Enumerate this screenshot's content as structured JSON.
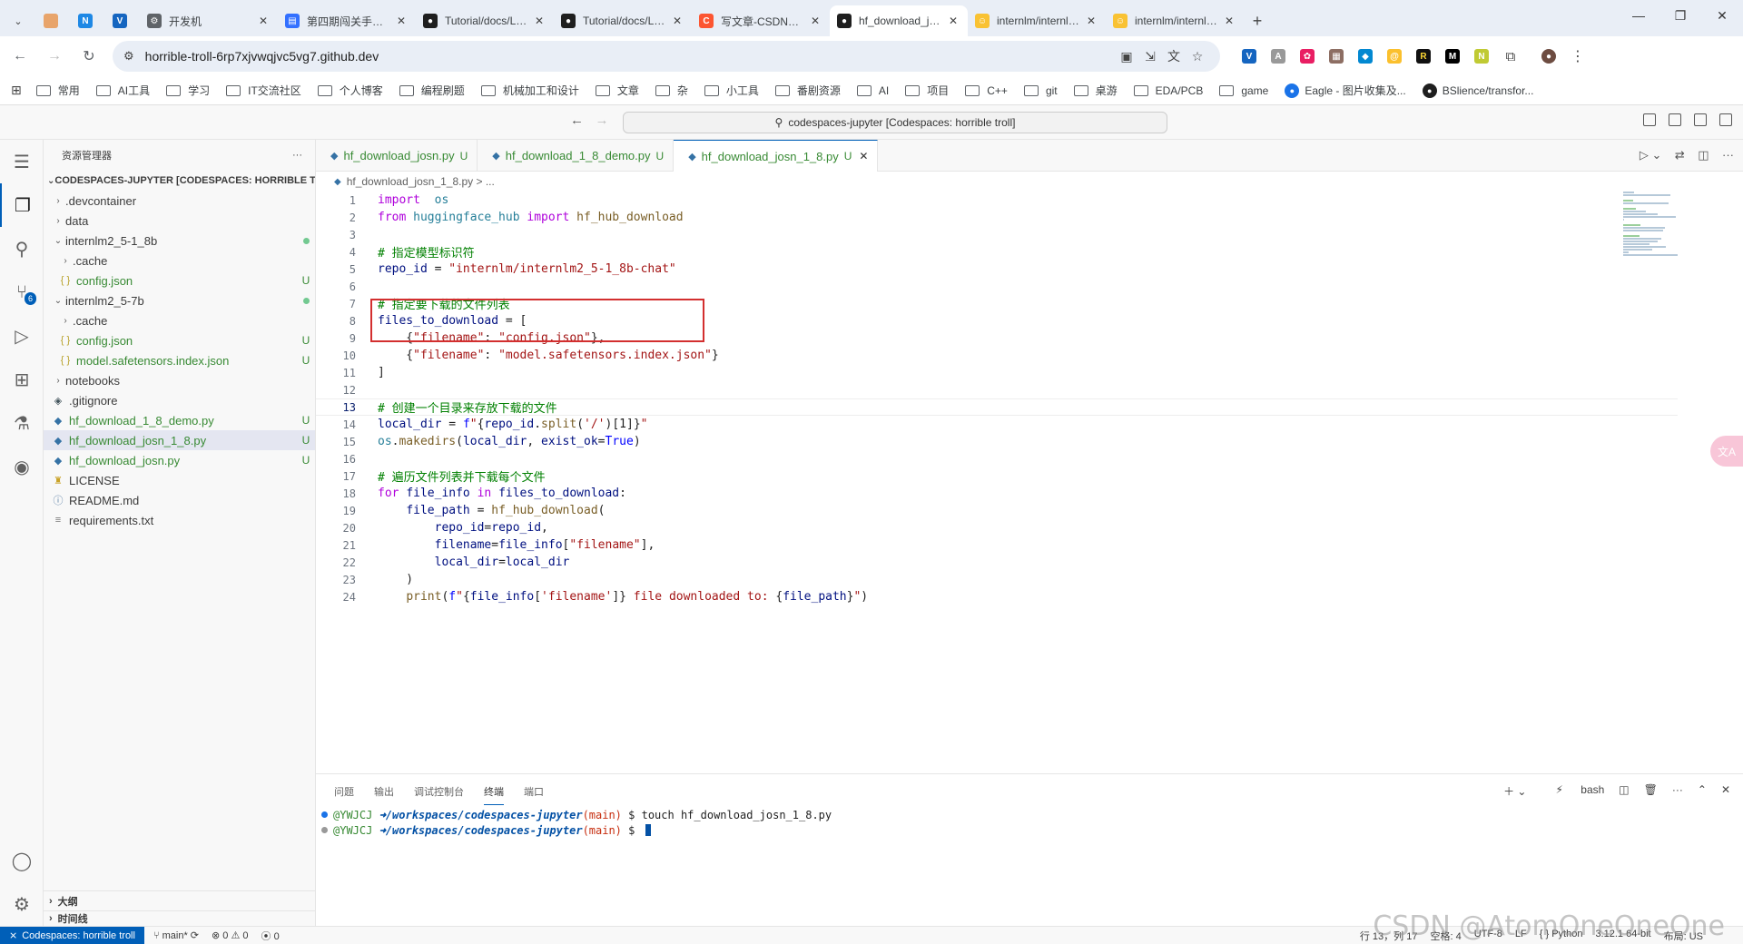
{
  "browser": {
    "tabs": [
      {
        "title": "",
        "icon_color": "#e8a46b",
        "icon_glyph": ""
      },
      {
        "title": "",
        "icon_color": "#1e88e5",
        "icon_glyph": "N"
      },
      {
        "title": "",
        "icon_color": "#1565c0",
        "icon_glyph": "V"
      },
      {
        "title": "开发机",
        "icon_color": "#5f6368",
        "icon_glyph": "⚙"
      },
      {
        "title": "第四期闯关手册 - 飞书",
        "icon_color": "#3370ff",
        "icon_glyph": "▤"
      },
      {
        "title": "Tutorial/docs/L0/ma",
        "icon_color": "#1f1f1f",
        "icon_glyph": "●"
      },
      {
        "title": "Tutorial/docs/L0/ma",
        "icon_color": "#1f1f1f",
        "icon_glyph": "●"
      },
      {
        "title": "写文章-CSDN博客",
        "icon_color": "#fc5531",
        "icon_glyph": "C"
      },
      {
        "title": "hf_download_josn_1",
        "icon_color": "#1f1f1f",
        "icon_glyph": "●",
        "active": true
      },
      {
        "title": "internlm/internlm2_",
        "icon_color": "#f9c233",
        "icon_glyph": "☺"
      },
      {
        "title": "internlm/internlm2_",
        "icon_color": "#f9c233",
        "icon_glyph": "☺"
      }
    ],
    "url": "horrible-troll-6rp7xjvwqjvc5vg7.github.dev",
    "bookmarks": [
      {
        "label": "常用",
        "type": "folder"
      },
      {
        "label": "AI工具",
        "type": "folder"
      },
      {
        "label": "学习",
        "type": "folder"
      },
      {
        "label": "IT交流社区",
        "type": "folder"
      },
      {
        "label": "个人博客",
        "type": "folder"
      },
      {
        "label": "编程刷题",
        "type": "folder"
      },
      {
        "label": "机械加工和设计",
        "type": "folder"
      },
      {
        "label": "文章",
        "type": "folder"
      },
      {
        "label": "杂",
        "type": "folder"
      },
      {
        "label": "小工具",
        "type": "folder"
      },
      {
        "label": "番剧资源",
        "type": "folder"
      },
      {
        "label": "AI",
        "type": "folder"
      },
      {
        "label": "项目",
        "type": "folder"
      },
      {
        "label": "C++",
        "type": "folder"
      },
      {
        "label": "git",
        "type": "folder"
      },
      {
        "label": "桌游",
        "type": "folder"
      },
      {
        "label": "EDA/PCB",
        "type": "folder"
      },
      {
        "label": "game",
        "type": "folder"
      },
      {
        "label": "Eagle - 图片收集及...",
        "type": "site",
        "color": "#1a73e8"
      },
      {
        "label": "BSlience/transfor...",
        "type": "site",
        "color": "#1f1f1f"
      }
    ]
  },
  "vscode": {
    "command_center": "codespaces-jupyter [Codespaces: horrible troll]",
    "explorer_title": "资源管理器",
    "root_label": "CODESPACES-JUPYTER [CODESPACES: HORRIBLE TR...",
    "tree": [
      {
        "name": ".devcontainer",
        "kind": "folder",
        "open": false,
        "depth": 0,
        "status": ""
      },
      {
        "name": "data",
        "kind": "folder",
        "open": false,
        "depth": 0,
        "status": ""
      },
      {
        "name": "internlm2_5-1_8b",
        "kind": "folder",
        "open": true,
        "depth": 0,
        "status": "dot"
      },
      {
        "name": ".cache",
        "kind": "folder",
        "open": false,
        "depth": 1,
        "status": ""
      },
      {
        "name": "config.json",
        "kind": "json",
        "depth": 1,
        "status": "U"
      },
      {
        "name": "internlm2_5-7b",
        "kind": "folder",
        "open": true,
        "depth": 0,
        "status": "dot"
      },
      {
        "name": ".cache",
        "kind": "folder",
        "open": false,
        "depth": 1,
        "status": ""
      },
      {
        "name": "config.json",
        "kind": "json",
        "depth": 1,
        "status": "U"
      },
      {
        "name": "model.safetensors.index.json",
        "kind": "json",
        "depth": 1,
        "status": "U"
      },
      {
        "name": "notebooks",
        "kind": "folder",
        "open": false,
        "depth": 0,
        "status": ""
      },
      {
        "name": ".gitignore",
        "kind": "git",
        "depth": 0,
        "status": ""
      },
      {
        "name": "hf_download_1_8_demo.py",
        "kind": "py",
        "depth": 0,
        "status": "U"
      },
      {
        "name": "hf_download_josn_1_8.py",
        "kind": "py",
        "depth": 0,
        "status": "U",
        "selected": true
      },
      {
        "name": "hf_download_josn.py",
        "kind": "py",
        "depth": 0,
        "status": "U"
      },
      {
        "name": "LICENSE",
        "kind": "license",
        "depth": 0,
        "status": ""
      },
      {
        "name": "README.md",
        "kind": "md",
        "depth": 0,
        "status": ""
      },
      {
        "name": "requirements.txt",
        "kind": "txt",
        "depth": 0,
        "status": ""
      }
    ],
    "outline_label": "大纲",
    "timeline_label": "时间线",
    "editor_tabs": [
      {
        "label": "hf_download_josn.py",
        "status": "U",
        "active": false
      },
      {
        "label": "hf_download_1_8_demo.py",
        "status": "U",
        "active": false
      },
      {
        "label": "hf_download_josn_1_8.py",
        "status": "U",
        "active": true
      }
    ],
    "breadcrumb": "hf_download_josn_1_8.py  >  ...",
    "code_lines": [
      [
        [
          "kw",
          "import"
        ],
        [
          "",
          "  "
        ],
        [
          "mod",
          "os"
        ]
      ],
      [
        [
          "kw",
          "from"
        ],
        [
          "",
          " "
        ],
        [
          "mod",
          "huggingface_hub"
        ],
        [
          "",
          " "
        ],
        [
          "kw",
          "import"
        ],
        [
          "",
          " "
        ],
        [
          "fn",
          "hf_hub_download"
        ]
      ],
      [],
      [
        [
          "com",
          "# 指定模型标识符"
        ]
      ],
      [
        [
          "var",
          "repo_id"
        ],
        [
          "",
          " = "
        ],
        [
          "str",
          "\"internlm/internlm2_5-1_8b-chat\""
        ]
      ],
      [],
      [
        [
          "com",
          "# 指定要下载的文件列表"
        ]
      ],
      [
        [
          "var",
          "files_to_download"
        ],
        [
          "",
          " = ["
        ]
      ],
      [
        [
          "",
          "    {"
        ],
        [
          "str",
          "\"filename\""
        ],
        [
          "",
          ": "
        ],
        [
          "str",
          "\"config.json\""
        ],
        [
          "",
          "},"
        ]
      ],
      [
        [
          "",
          "    {"
        ],
        [
          "str",
          "\"filename\""
        ],
        [
          "",
          ": "
        ],
        [
          "str",
          "\"model.safetensors.index.json\""
        ],
        [
          "",
          "}"
        ]
      ],
      [
        [
          "",
          "]"
        ]
      ],
      [],
      [
        [
          "com",
          "# 创建一个目录来存放下载的文件"
        ]
      ],
      [
        [
          "var",
          "local_dir"
        ],
        [
          "",
          " = "
        ],
        [
          "kw2",
          "f"
        ],
        [
          "str",
          "\""
        ],
        [
          "",
          "{"
        ],
        [
          "var",
          "repo_id"
        ],
        [
          "",
          "."
        ],
        [
          "fn",
          "split"
        ],
        [
          "",
          "("
        ],
        [
          "str",
          "'/'"
        ],
        [
          ")",
          ")"
        ],
        [
          "",
          "[1]"
        ],
        [
          "",
          "}"
        ],
        [
          "str",
          "\""
        ]
      ],
      [
        [
          "mod",
          "os"
        ],
        [
          "",
          "."
        ],
        [
          "fn",
          "makedirs"
        ],
        [
          "",
          "("
        ],
        [
          "var",
          "local_dir"
        ],
        [
          "",
          ", "
        ],
        [
          "var",
          "exist_ok"
        ],
        [
          "",
          "="
        ],
        [
          "kw2",
          "True"
        ],
        [
          "",
          ")"
        ]
      ],
      [],
      [
        [
          "com",
          "# 遍历文件列表并下载每个文件"
        ]
      ],
      [
        [
          "kw",
          "for"
        ],
        [
          "",
          " "
        ],
        [
          "var",
          "file_info"
        ],
        [
          "",
          " "
        ],
        [
          "kw",
          "in"
        ],
        [
          "",
          " "
        ],
        [
          "var",
          "files_to_download"
        ],
        [
          "",
          ":"
        ]
      ],
      [
        [
          "",
          "    "
        ],
        [
          "var",
          "file_path"
        ],
        [
          "",
          " = "
        ],
        [
          "fn",
          "hf_hub_download"
        ],
        [
          "",
          "("
        ]
      ],
      [
        [
          "",
          "        "
        ],
        [
          "var",
          "repo_id"
        ],
        [
          "",
          "="
        ],
        [
          "var",
          "repo_id"
        ],
        [
          "",
          ","
        ]
      ],
      [
        [
          "",
          "        "
        ],
        [
          "var",
          "filename"
        ],
        [
          "",
          "="
        ],
        [
          "var",
          "file_info"
        ],
        [
          "",
          "["
        ],
        [
          "str",
          "\"filename\""
        ],
        [
          "",
          "],"
        ]
      ],
      [
        [
          "",
          "        "
        ],
        [
          "var",
          "local_dir"
        ],
        [
          "",
          "="
        ],
        [
          "var",
          "local_dir"
        ]
      ],
      [
        [
          "",
          "    )"
        ]
      ],
      [
        [
          "",
          "    "
        ],
        [
          "fn",
          "print"
        ],
        [
          "",
          "("
        ],
        [
          "kw2",
          "f"
        ],
        [
          "str",
          "\""
        ],
        [
          "",
          "{"
        ],
        [
          "var",
          "file_info"
        ],
        [
          "",
          "["
        ],
        [
          "str",
          "'filename'"
        ],
        [
          "",
          "]}"
        ],
        [
          "str",
          " file downloaded to: "
        ],
        [
          "",
          "{"
        ],
        [
          "var",
          "file_path"
        ],
        [
          "",
          "}"
        ],
        [
          "str",
          "\""
        ],
        [
          "",
          ")"
        ]
      ]
    ],
    "current_line": 13,
    "panel_tabs": [
      "问题",
      "输出",
      "调试控制台",
      "终端",
      "端口"
    ],
    "active_panel_tab": 3,
    "terminal_shell": "bash",
    "terminal_lines": [
      {
        "user": "@YWJCJ",
        "path": "/workspaces/codespaces-jupyter",
        "branch": "(main)",
        "cmd": "touch hf_download_josn_1_8.py",
        "dot_color": "#1a73e8"
      },
      {
        "user": "@YWJCJ",
        "path": "/workspaces/codespaces-jupyter",
        "branch": "(main)",
        "cmd": "",
        "dot_color": "#999999"
      }
    ],
    "status": {
      "remote": "Codespaces: horrible troll",
      "branch": "main*",
      "errors": "0",
      "warnings": "0",
      "ports": "0",
      "position": "行 13，列 17",
      "spaces": "空格: 4",
      "encoding": "UTF-8",
      "eol": "LF",
      "language": "Python",
      "version": "3.12.1 64-bit",
      "layout": "布局: US"
    }
  },
  "watermark": "CSDN @AtomOneOneOne"
}
